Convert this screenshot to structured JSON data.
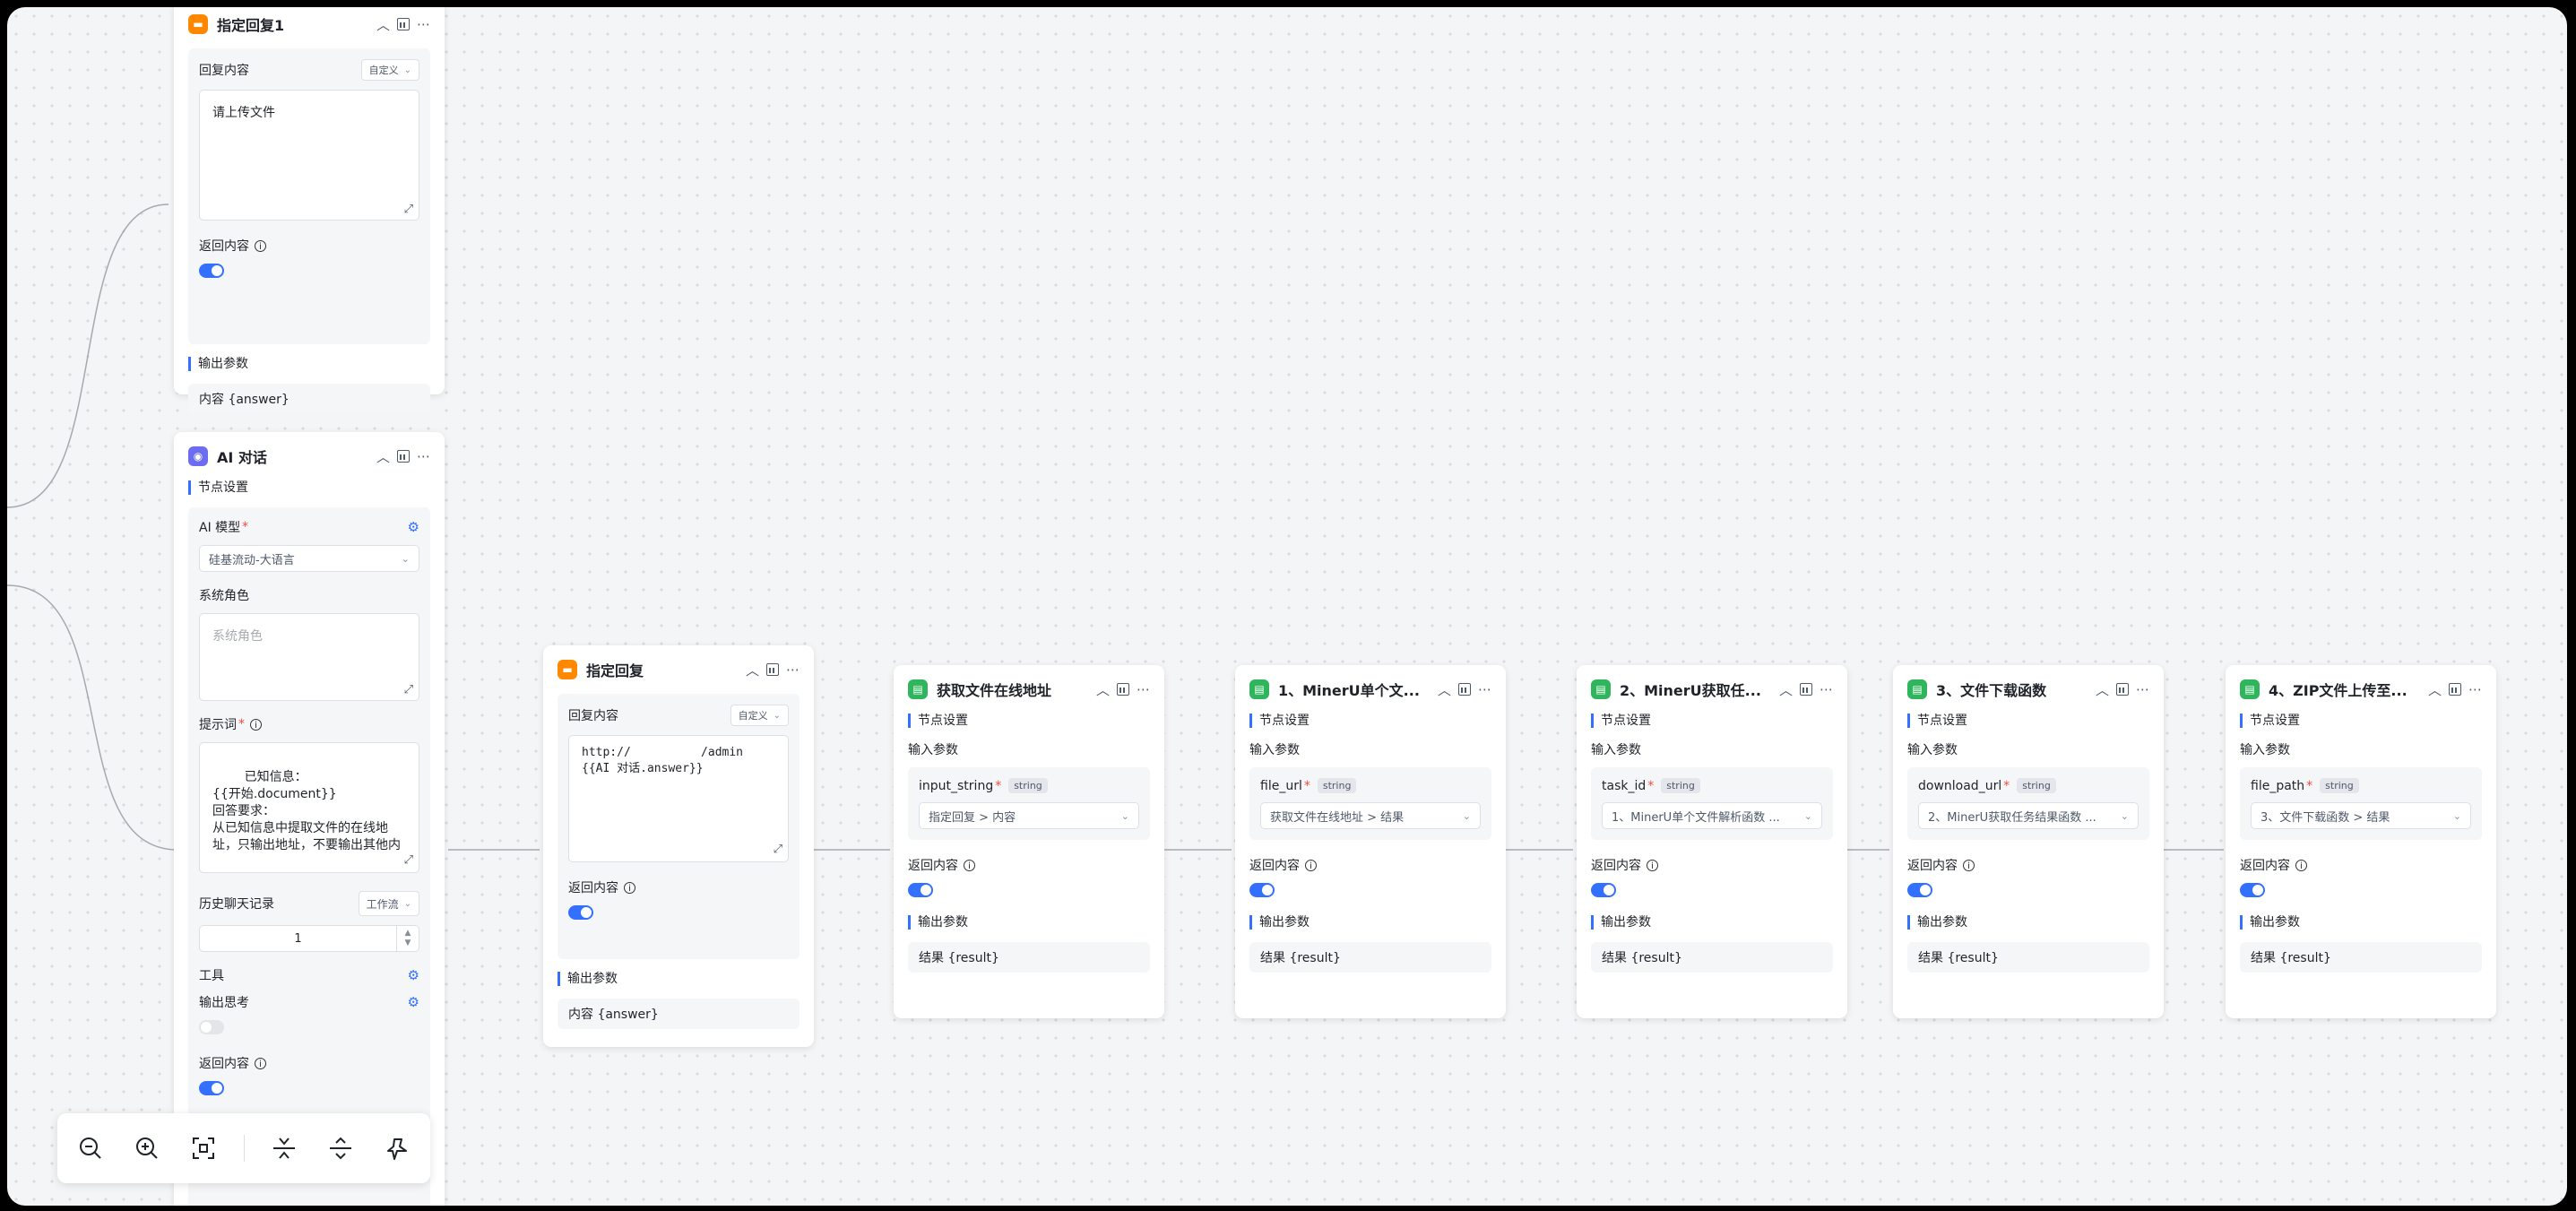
{
  "nodes": {
    "reply1": {
      "title": "指定回复1",
      "content_label": "回复内容",
      "mode": "自定义",
      "content": "请上传文件",
      "return_label": "返回内容",
      "output_label": "输出参数",
      "output_value": "内容 {answer}"
    },
    "ai": {
      "title": "AI 对话",
      "settings_label": "节点设置",
      "model_label": "AI 模型",
      "model_value": "硅基流动-大语言",
      "role_label": "系统角色",
      "role_placeholder": "系统角色",
      "prompt_label": "提示词",
      "prompt_text": "已知信息：\n{{开始.document}}\n回答要求：\n从已知信息中提取文件的在线地\n址，只输出地址，不要输出其他内",
      "history_label": "历史聊天记录",
      "history_mode": "工作流",
      "history_count": "1",
      "tools_label": "工具",
      "think_label": "输出思考",
      "return_label": "返回内容"
    },
    "reply2": {
      "title": "指定回复",
      "content_label": "回复内容",
      "mode": "自定义",
      "content": "http://          /admin\n{{AI 对话.answer}}",
      "return_label": "返回内容",
      "output_label": "输出参数",
      "output_value": "内容 {answer}"
    },
    "fn": [
      {
        "title": "获取文件在线地址",
        "settings_label": "节点设置",
        "input_label": "输入参数",
        "param_name": "input_string",
        "param_type": "string",
        "param_value": "指定回复 > 内容",
        "return_label": "返回内容",
        "output_label": "输出参数",
        "output_value": "结果 {result}"
      },
      {
        "title": "1、MinerU单个文...",
        "settings_label": "节点设置",
        "input_label": "输入参数",
        "param_name": "file_url",
        "param_type": "string",
        "param_value": "获取文件在线地址 > 结果",
        "return_label": "返回内容",
        "output_label": "输出参数",
        "output_value": "结果 {result}"
      },
      {
        "title": "2、MinerU获取任...",
        "settings_label": "节点设置",
        "input_label": "输入参数",
        "param_name": "task_id",
        "param_type": "string",
        "param_value": "1、MinerU单个文件解析函数 ...",
        "return_label": "返回内容",
        "output_label": "输出参数",
        "output_value": "结果 {result}"
      },
      {
        "title": "3、文件下载函数",
        "settings_label": "节点设置",
        "input_label": "输入参数",
        "param_name": "download_url",
        "param_type": "string",
        "param_value": "2、MinerU获取任务结果函数 ...",
        "return_label": "返回内容",
        "output_label": "输出参数",
        "output_value": "结果 {result}"
      },
      {
        "title": "4、ZIP文件上传至...",
        "settings_label": "节点设置",
        "input_label": "输入参数",
        "param_name": "file_path",
        "param_type": "string",
        "param_value": "3、文件下载函数 > 结果",
        "return_label": "返回内容",
        "output_label": "输出参数",
        "output_value": "结果 {result}"
      }
    ]
  },
  "toolbar": {
    "icons": [
      "zoom-out-icon",
      "zoom-in-icon",
      "fit-view-icon",
      "collapse-all-icon",
      "expand-all-icon",
      "auto-layout-icon"
    ]
  },
  "colors": {
    "accent": "#3370ff",
    "reply_icon": "#ff8800",
    "ai_icon": "#6c6cf2",
    "function_icon": "#2fb55b"
  }
}
